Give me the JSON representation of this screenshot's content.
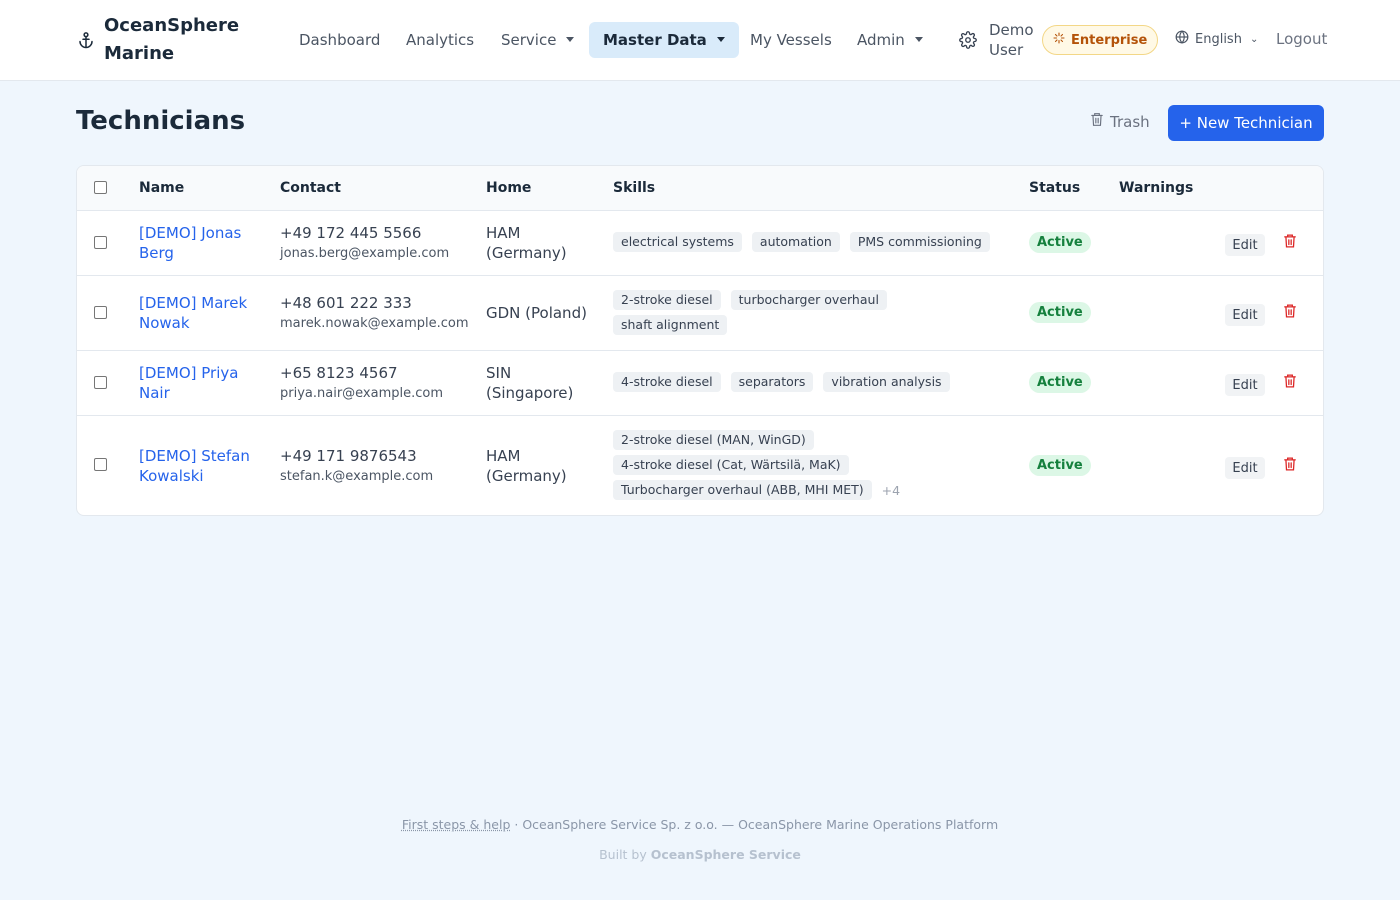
{
  "brand": {
    "name": "OceanSphere Marine"
  },
  "nav": {
    "items": [
      {
        "label": "Dashboard",
        "dropdown": false,
        "active": false
      },
      {
        "label": "Analytics",
        "dropdown": false,
        "active": false
      },
      {
        "label": "Service",
        "dropdown": true,
        "active": false
      },
      {
        "label": "Master Data",
        "dropdown": true,
        "active": true
      },
      {
        "label": "My Vessels",
        "dropdown": false,
        "active": false
      },
      {
        "label": "Admin",
        "dropdown": true,
        "active": false
      }
    ],
    "user": "Demo User",
    "plan": "Enterprise",
    "language": "English",
    "logout": "Logout"
  },
  "page": {
    "title": "Technicians",
    "trash_label": "Trash",
    "new_label": "+ New Technician"
  },
  "table": {
    "columns": [
      "Name",
      "Contact",
      "Home",
      "Skills",
      "Status",
      "Warnings"
    ],
    "edit_label": "Edit",
    "rows": [
      {
        "name": "[DEMO] Jonas Berg",
        "phone": "+49 172 445 5566",
        "email": "jonas.berg@example.com",
        "home": "HAM (Germany)",
        "skills": [
          "electrical systems",
          "automation",
          "PMS commissioning"
        ],
        "more": "",
        "status": "Active"
      },
      {
        "name": "[DEMO] Marek Nowak",
        "phone": "+48 601 222 333",
        "email": "marek.nowak@example.com",
        "home": "GDN (Poland)",
        "skills": [
          "2-stroke diesel",
          "turbocharger overhaul",
          "shaft alignment"
        ],
        "more": "",
        "status": "Active"
      },
      {
        "name": "[DEMO] Priya Nair",
        "phone": "+65 8123 4567",
        "email": "priya.nair@example.com",
        "home": "SIN (Singapore)",
        "skills": [
          "4-stroke diesel",
          "separators",
          "vibration analysis"
        ],
        "more": "",
        "status": "Active"
      },
      {
        "name": "[DEMO] Stefan Kowalski",
        "phone": "+49 171 9876543",
        "email": "stefan.k@example.com",
        "home": "HAM (Germany)",
        "skills": [
          "2-stroke diesel (MAN, WinGD)",
          "4-stroke diesel (Cat, Wärtsilä, MaK)",
          "Turbocharger overhaul (ABB, MHI MET)"
        ],
        "more": "+4",
        "status": "Active"
      }
    ]
  },
  "footer": {
    "help": "First steps & help",
    "company": " · OceanSphere Service Sp. z o.o. — OceanSphere Marine Operations Platform",
    "built_prefix": "Built by ",
    "built_name": "OceanSphere Service"
  },
  "colors": {
    "primary": "#2563eb",
    "active_nav_bg": "#d9ebfa",
    "status_active_bg": "#dcf7e6",
    "status_active_text": "#15803d",
    "danger": "#dc2626",
    "plan_badge": "#b45309"
  }
}
